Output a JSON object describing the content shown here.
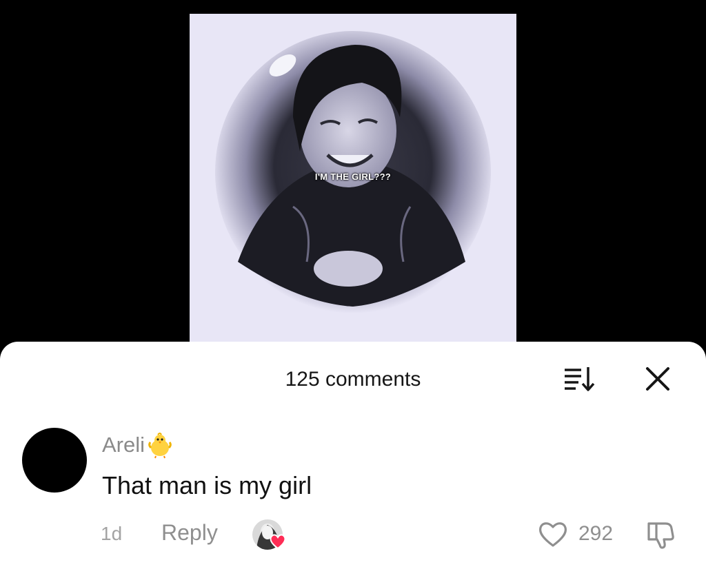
{
  "video": {
    "caption": "I'M THE GIRL???"
  },
  "comments_panel": {
    "title": "125 comments",
    "sort_icon": "sort-icon",
    "close_icon": "close-icon"
  },
  "comment": {
    "username": "Areli",
    "username_emoji": "baby-chick-emoji",
    "text": "That man is my girl",
    "time": "1d",
    "reply_label": "Reply",
    "like_count": "292",
    "creator_liked": true
  },
  "colors": {
    "background": "#000000",
    "sheet": "#ffffff",
    "muted_text": "#8f8f8f",
    "heart_accent": "#fe2c55"
  }
}
